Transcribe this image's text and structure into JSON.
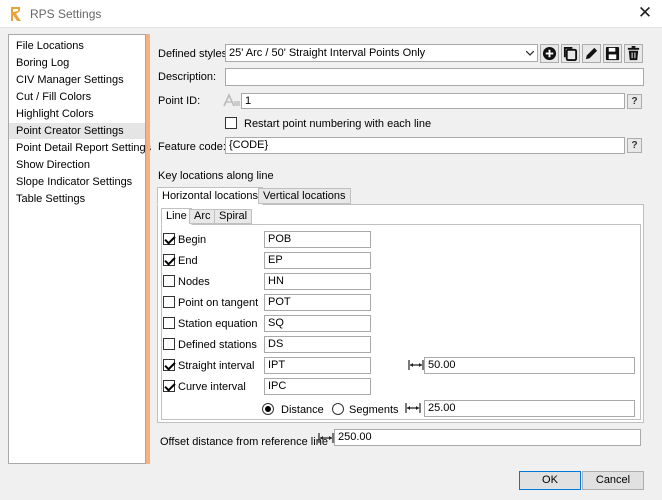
{
  "window": {
    "title": "RPS Settings"
  },
  "nav": {
    "items": [
      "File Locations",
      "Boring Log",
      "CIV Manager Settings",
      "Cut / Fill Colors",
      "Highlight Colors",
      "Point Creator Settings",
      "Point Detail Report Settings",
      "Show Direction",
      "Slope Indicator Settings",
      "Table Settings"
    ],
    "selected_index": 5
  },
  "form": {
    "defined_styles_label": "Defined styles",
    "defined_styles_value": "25' Arc / 50' Straight Interval Points Only",
    "description_label": "Description:",
    "description_value": "",
    "point_id_label": "Point ID:",
    "point_id_value": "1",
    "restart_label": "Restart point numbering with each line",
    "feature_code_label": "Feature code:",
    "feature_code_value": "{CODE}",
    "help_glyph": "?",
    "key_locations_label": "Key locations along line",
    "offset_label": "Offset distance from reference line",
    "offset_value": "250.00"
  },
  "tabs": {
    "outer": [
      "Horizontal locations",
      "Vertical locations"
    ],
    "inner": [
      "Line",
      "Arc",
      "Spiral"
    ]
  },
  "rows": [
    {
      "label": "Begin",
      "checked": true,
      "code": "POB"
    },
    {
      "label": "End",
      "checked": true,
      "code": "EP"
    },
    {
      "label": "Nodes",
      "checked": false,
      "code": "HN"
    },
    {
      "label": "Point on tangent",
      "checked": false,
      "code": "POT"
    },
    {
      "label": "Station equation",
      "checked": false,
      "code": "SQ"
    },
    {
      "label": "Defined stations",
      "checked": false,
      "code": "DS"
    },
    {
      "label": "Straight interval",
      "checked": true,
      "code": "IPT"
    },
    {
      "label": "Curve interval",
      "checked": true,
      "code": "IPC"
    }
  ],
  "interval": {
    "straight_value": "50.00",
    "curve_value": "25.00",
    "distance_label": "Distance",
    "segments_label": "Segments",
    "mode": "Distance"
  },
  "buttons": {
    "ok": "OK",
    "cancel": "Cancel"
  },
  "icons": [
    "app-icon",
    "close-icon",
    "add-icon",
    "copy-icon",
    "edit-icon",
    "save-icon",
    "delete-icon",
    "dropdown-arrow-icon",
    "point-id-icon",
    "dimension-icon"
  ]
}
